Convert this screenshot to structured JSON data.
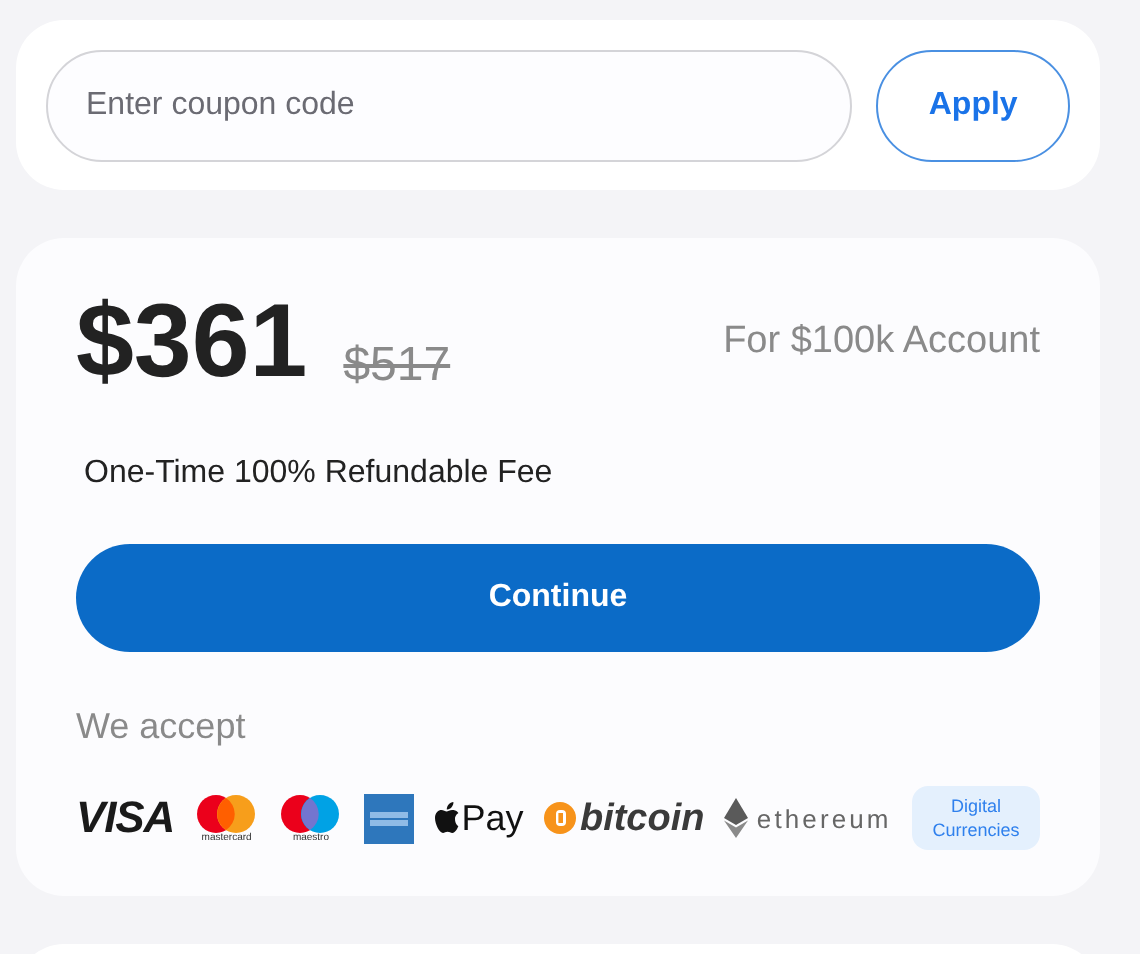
{
  "coupon": {
    "placeholder": "Enter coupon code",
    "button": "Apply"
  },
  "pricing": {
    "price": "$361",
    "old_price": "$517",
    "account": "For $100k Account",
    "fee_note": "One-Time 100% Refundable Fee",
    "button": "Continue",
    "accept_label": "We accept",
    "methods": [
      {
        "kind": "visa",
        "label": "VISA"
      },
      {
        "kind": "mastercard",
        "label": "mastercard"
      },
      {
        "kind": "maestro",
        "label": "maestro"
      },
      {
        "kind": "amex"
      },
      {
        "kind": "applepay",
        "label": "Pay"
      },
      {
        "kind": "bitcoin",
        "label": "bitcoin"
      },
      {
        "kind": "ethereum",
        "label": "ethereum"
      },
      {
        "kind": "badge",
        "label": "Digital Currencies"
      }
    ]
  }
}
